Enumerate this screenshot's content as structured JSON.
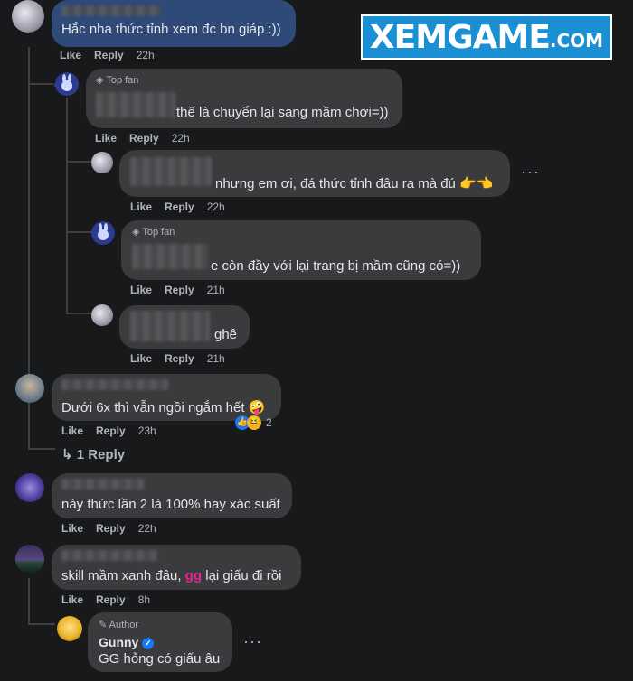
{
  "logo": {
    "main": "XEMGAME",
    "suffix": ".COM"
  },
  "actions": {
    "like": "Like",
    "reply": "Reply"
  },
  "comments": [
    {
      "text": "Hắc nha thức tỉnh xem đc bn giáp :))",
      "time": "22h"
    },
    {
      "badge": "Top fan",
      "text": "thế là chuyển lại sang mầm chơi=))",
      "time": "22h"
    },
    {
      "text": "nhưng em ơi, đá thức tỉnh đâu ra mà đú 👉👈",
      "time": "22h"
    },
    {
      "badge": "Top fan",
      "text": "e còn đầy với lại trang bị mầm cũng có=))",
      "time": "21h"
    },
    {
      "text": "ghê",
      "time": "21h"
    },
    {
      "text": "Dưới 6x thì vẫn ngồi ngắm hết 🤪",
      "time": "23h",
      "reaction_count": "2"
    },
    {
      "text": "này thức lần 2 là 100% hay xác suất",
      "time": "22h"
    },
    {
      "text_before": "skill mầm xanh đâu, ",
      "text_highlight": "gg",
      "text_after": " lại giấu đi rồi",
      "time": "8h"
    },
    {
      "badge": "Author",
      "name": "Gunny",
      "text": "GG hỏng có giấu âu"
    }
  ],
  "view_replies": "1 Reply",
  "more_menu": "···"
}
